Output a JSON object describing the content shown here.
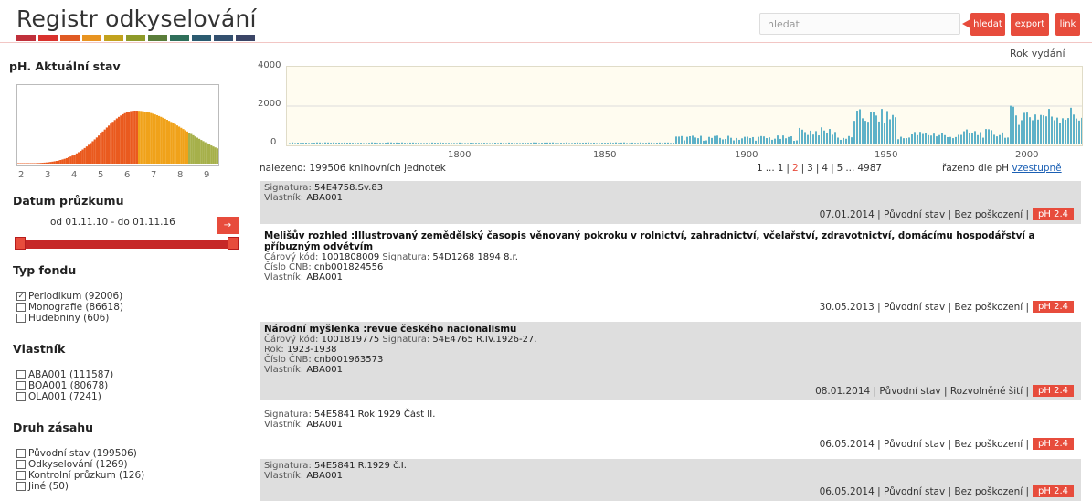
{
  "header": {
    "title": "Registr odkyselování",
    "palette": [
      "#c0303b",
      "#d9322d",
      "#e05a23",
      "#e89421",
      "#c2a21d",
      "#8e9a29",
      "#5a7d3a",
      "#2f6f5a",
      "#2b5b70",
      "#33506f",
      "#3b4566"
    ],
    "search_placeholder": "hledat",
    "search_button": "hledat",
    "export_button": "export",
    "link_button": "link"
  },
  "sidebar": {
    "ph_title": "pH. Aktuální stav",
    "ph_axis": [
      "2",
      "3",
      "4",
      "5",
      "6",
      "7",
      "8",
      "9"
    ],
    "date_title": "Datum průzkumu",
    "date_range": "od 01.11.10 - do 01.11.16",
    "date_button": "→",
    "fund_title": "Typ fondu",
    "funds": [
      {
        "label": "Periodikum (92006)",
        "checked": true
      },
      {
        "label": "Monografie (86618)",
        "checked": false
      },
      {
        "label": "Hudebniny (606)",
        "checked": false
      }
    ],
    "owner_title": "Vlastník",
    "owners": [
      {
        "label": "ABA001 (111587)",
        "checked": false
      },
      {
        "label": "BOA001 (80678)",
        "checked": false
      },
      {
        "label": "OLA001 (7241)",
        "checked": false
      }
    ],
    "intervention_title": "Druh zásahu",
    "interventions": [
      {
        "label": "Původní stav (199506)",
        "checked": false
      },
      {
        "label": "Odkyselování (1269)",
        "checked": false
      },
      {
        "label": "Kontrolní průzkum (126)",
        "checked": false
      },
      {
        "label": "Jiné (50)",
        "checked": false
      }
    ]
  },
  "chart": {
    "title": "Rok vydání",
    "yticks": [
      "4000",
      "2000",
      "0"
    ],
    "xticks": [
      "1800",
      "1850",
      "1900",
      "1950",
      "2000"
    ]
  },
  "results": {
    "found": "nalezeno: 199506 knihovních jednotek",
    "pages": [
      "1",
      "...",
      "1",
      "|",
      "2",
      "|",
      "3",
      "|",
      "4",
      "|",
      "5",
      "...",
      "4987"
    ],
    "sort_text": "řazeno dle pH",
    "sort_link": "vzestupně"
  },
  "records": [
    {
      "title": "",
      "lines": [
        [
          "Signatura: ",
          "54E4758.Sv.83"
        ],
        [
          "Vlastník: ",
          "ABA001"
        ]
      ],
      "date": "07.01.2014",
      "state": "Původní stav",
      "damage": "Bez poškození",
      "ph": "pH 2.4"
    },
    {
      "title": "Melišův rozhled :Illustrovaný zemědělský časopis věnovaný pokroku v rolnictví, zahradnictví, včelařství, zdravotnictví, domácímu hospodářství a příbuzným odvětvím",
      "lines": [
        [
          "Čárový kód: ",
          "1001808009",
          " Signatura: ",
          "54D1268 1894 8.r."
        ],
        [
          "Číslo ČNB: ",
          "cnb001824556"
        ],
        [
          "Vlastník: ",
          "ABA001"
        ]
      ],
      "date": "30.05.2013",
      "state": "Původní stav",
      "damage": "Bez poškození",
      "ph": "pH 2.4"
    },
    {
      "title": "Národní myšlenka :revue českého nacionalismu",
      "lines": [
        [
          "Čárový kód: ",
          "1001819775",
          " Signatura: ",
          "54E4765 R.IV.1926-27."
        ],
        [
          "Rok: ",
          "1923-1938"
        ],
        [
          "Číslo ČNB: ",
          "cnb001963573"
        ],
        [
          "Vlastník: ",
          "ABA001"
        ]
      ],
      "date": "08.01.2014",
      "state": "Původní stav",
      "damage": "Rozvolněné šití",
      "ph": "pH 2.4"
    },
    {
      "title": "",
      "lines": [
        [
          "Signatura: ",
          "54E5841 Rok 1929 Část II."
        ],
        [
          "Vlastník: ",
          "ABA001"
        ]
      ],
      "date": "06.05.2014",
      "state": "Původní stav",
      "damage": "Bez poškození",
      "ph": "pH 2.4"
    },
    {
      "title": "",
      "lines": [
        [
          "Signatura: ",
          "54E5841 R.1929 č.I."
        ],
        [
          "Vlastník: ",
          "ABA001"
        ]
      ],
      "date": "06.05.2014",
      "state": "Původní stav",
      "damage": "Bez poškození",
      "ph": "pH 2.4"
    }
  ]
}
